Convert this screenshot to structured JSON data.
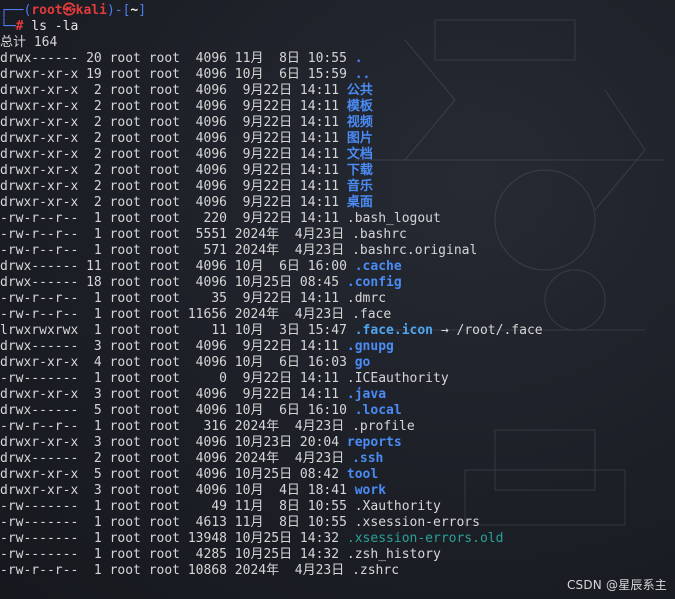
{
  "prompt": {
    "top_bar": "┌──(",
    "user": "root㉿kali",
    "close_paren": ")-[",
    "path": "~",
    "close_bracket": "]",
    "bottom_bar": "└─",
    "hash": "#",
    "command": " ls -la"
  },
  "total_line": "总计 164",
  "entries": [
    {
      "perms": "drwx------",
      "links": "20",
      "owner": "root",
      "group": "root",
      "size": "4096",
      "date": "11月  8日",
      "time": "10:55",
      "name": ".",
      "kind": "dir"
    },
    {
      "perms": "drwxr-xr-x",
      "links": "19",
      "owner": "root",
      "group": "root",
      "size": "4096",
      "date": "10月  6日",
      "time": "15:59",
      "name": "..",
      "kind": "dir"
    },
    {
      "perms": "drwxr-xr-x",
      "links": " 2",
      "owner": "root",
      "group": "root",
      "size": "4096",
      "date": " 9月22日",
      "time": "14:11",
      "name": "公共",
      "kind": "dir"
    },
    {
      "perms": "drwxr-xr-x",
      "links": " 2",
      "owner": "root",
      "group": "root",
      "size": "4096",
      "date": " 9月22日",
      "time": "14:11",
      "name": "模板",
      "kind": "dir"
    },
    {
      "perms": "drwxr-xr-x",
      "links": " 2",
      "owner": "root",
      "group": "root",
      "size": "4096",
      "date": " 9月22日",
      "time": "14:11",
      "name": "视频",
      "kind": "dir"
    },
    {
      "perms": "drwxr-xr-x",
      "links": " 2",
      "owner": "root",
      "group": "root",
      "size": "4096",
      "date": " 9月22日",
      "time": "14:11",
      "name": "图片",
      "kind": "dir"
    },
    {
      "perms": "drwxr-xr-x",
      "links": " 2",
      "owner": "root",
      "group": "root",
      "size": "4096",
      "date": " 9月22日",
      "time": "14:11",
      "name": "文档",
      "kind": "dir"
    },
    {
      "perms": "drwxr-xr-x",
      "links": " 2",
      "owner": "root",
      "group": "root",
      "size": "4096",
      "date": " 9月22日",
      "time": "14:11",
      "name": "下载",
      "kind": "dir"
    },
    {
      "perms": "drwxr-xr-x",
      "links": " 2",
      "owner": "root",
      "group": "root",
      "size": "4096",
      "date": " 9月22日",
      "time": "14:11",
      "name": "音乐",
      "kind": "dir"
    },
    {
      "perms": "drwxr-xr-x",
      "links": " 2",
      "owner": "root",
      "group": "root",
      "size": "4096",
      "date": " 9月22日",
      "time": "14:11",
      "name": "桌面",
      "kind": "dir"
    },
    {
      "perms": "-rw-r--r--",
      "links": " 1",
      "owner": "root",
      "group": "root",
      "size": " 220",
      "date": " 9月22日",
      "time": "14:11",
      "name": ".bash_logout",
      "kind": "file"
    },
    {
      "perms": "-rw-r--r--",
      "links": " 1",
      "owner": "root",
      "group": "root",
      "size": "5551",
      "date": "2024年  4月23日",
      "time": "",
      "name": ".bashrc",
      "kind": "file"
    },
    {
      "perms": "-rw-r--r--",
      "links": " 1",
      "owner": "root",
      "group": "root",
      "size": " 571",
      "date": "2024年  4月23日",
      "time": "",
      "name": ".bashrc.original",
      "kind": "file"
    },
    {
      "perms": "drwx------",
      "links": "11",
      "owner": "root",
      "group": "root",
      "size": "4096",
      "date": "10月  6日",
      "time": "16:00",
      "name": ".cache",
      "kind": "dir"
    },
    {
      "perms": "drwx------",
      "links": "18",
      "owner": "root",
      "group": "root",
      "size": "4096",
      "date": "10月25日",
      "time": "08:45",
      "name": ".config",
      "kind": "dir"
    },
    {
      "perms": "-rw-r--r--",
      "links": " 1",
      "owner": "root",
      "group": "root",
      "size": "  35",
      "date": " 9月22日",
      "time": "14:11",
      "name": ".dmrc",
      "kind": "file"
    },
    {
      "perms": "-rw-r--r--",
      "links": " 1",
      "owner": "root",
      "group": "root",
      "size": "11656",
      "date": "2024年  4月23日",
      "time": "",
      "name": ".face",
      "kind": "file"
    },
    {
      "perms": "lrwxrwxrwx",
      "links": " 1",
      "owner": "root",
      "group": "root",
      "size": "  11",
      "date": "10月  3日",
      "time": "15:47",
      "name": ".face.icon",
      "kind": "link",
      "target": "/root/.face"
    },
    {
      "perms": "drwx------",
      "links": " 3",
      "owner": "root",
      "group": "root",
      "size": "4096",
      "date": " 9月22日",
      "time": "14:11",
      "name": ".gnupg",
      "kind": "dir"
    },
    {
      "perms": "drwxr-xr-x",
      "links": " 4",
      "owner": "root",
      "group": "root",
      "size": "4096",
      "date": "10月  6日",
      "time": "16:03",
      "name": "go",
      "kind": "dir"
    },
    {
      "perms": "-rw-------",
      "links": " 1",
      "owner": "root",
      "group": "root",
      "size": "   0",
      "date": " 9月22日",
      "time": "14:11",
      "name": ".ICEauthority",
      "kind": "file"
    },
    {
      "perms": "drwxr-xr-x",
      "links": " 3",
      "owner": "root",
      "group": "root",
      "size": "4096",
      "date": " 9月22日",
      "time": "14:11",
      "name": ".java",
      "kind": "dir"
    },
    {
      "perms": "drwx------",
      "links": " 5",
      "owner": "root",
      "group": "root",
      "size": "4096",
      "date": "10月  6日",
      "time": "16:10",
      "name": ".local",
      "kind": "dir"
    },
    {
      "perms": "-rw-r--r--",
      "links": " 1",
      "owner": "root",
      "group": "root",
      "size": " 316",
      "date": "2024年  4月23日",
      "time": "",
      "name": ".profile",
      "kind": "file"
    },
    {
      "perms": "drwxr-xr-x",
      "links": " 3",
      "owner": "root",
      "group": "root",
      "size": "4096",
      "date": "10月23日",
      "time": "20:04",
      "name": "reports",
      "kind": "dir"
    },
    {
      "perms": "drwx------",
      "links": " 2",
      "owner": "root",
      "group": "root",
      "size": "4096",
      "date": "2024年  4月23日",
      "time": "",
      "name": ".ssh",
      "kind": "dir"
    },
    {
      "perms": "drwxr-xr-x",
      "links": " 5",
      "owner": "root",
      "group": "root",
      "size": "4096",
      "date": "10月25日",
      "time": "08:42",
      "name": "tool",
      "kind": "dir"
    },
    {
      "perms": "drwxr-xr-x",
      "links": " 3",
      "owner": "root",
      "group": "root",
      "size": "4096",
      "date": "10月  4日",
      "time": "18:41",
      "name": "work",
      "kind": "dir"
    },
    {
      "perms": "-rw-------",
      "links": " 1",
      "owner": "root",
      "group": "root",
      "size": "  49",
      "date": "11月  8日",
      "time": "10:55",
      "name": ".Xauthority",
      "kind": "file"
    },
    {
      "perms": "-rw-------",
      "links": " 1",
      "owner": "root",
      "group": "root",
      "size": "4613",
      "date": "11月  8日",
      "time": "10:55",
      "name": ".xsession-errors",
      "kind": "file"
    },
    {
      "perms": "-rw-------",
      "links": " 1",
      "owner": "root",
      "group": "root",
      "size": "13948",
      "date": "10月25日",
      "time": "14:32",
      "name": ".xsession-errors.old",
      "kind": "old"
    },
    {
      "perms": "-rw-------",
      "links": " 1",
      "owner": "root",
      "group": "root",
      "size": "4285",
      "date": "10月25日",
      "time": "14:32",
      "name": ".zsh_history",
      "kind": "file"
    },
    {
      "perms": "-rw-r--r--",
      "links": " 1",
      "owner": "root",
      "group": "root",
      "size": "10868",
      "date": "2024年  4月23日",
      "time": "",
      "name": ".zshrc",
      "kind": "file"
    }
  ],
  "watermark": "CSDN @星辰系主",
  "colors": {
    "background": "#1c1f26",
    "prompt_red": "#e23b3b",
    "prompt_blue": "#4f7cf0",
    "directory": "#4a8bf5",
    "symlink": "#4ea6f0",
    "old_file": "#2aa198",
    "text": "#d6d6d6"
  }
}
